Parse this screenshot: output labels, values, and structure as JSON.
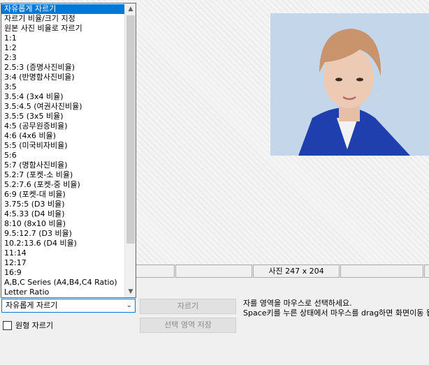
{
  "dropdown": {
    "items": [
      "자유롭게 자르기",
      "자르기 비율/크기 지정",
      "원본 사진 비율로 자르기",
      "1:1",
      "1:2",
      "2:3",
      "2.5:3 (증명사진비율)",
      "3:4 (반명함사진비율)",
      "3:5",
      "3.5:4 (3x4 비율)",
      "3.5:4.5 (여권사진비율)",
      "3.5:5 (3x5 비율)",
      "4:5 (공무원증비율)",
      "4:6 (4x6 비율)",
      "5:5 (미국비자비율)",
      "5:6",
      "5:7 (명함사진비율)",
      "5.2:7 (포켓-소 비율)",
      "5.2:7.6 (포켓-중 비율)",
      "6:9 (포켓-대 비율)",
      "3.75:5 (D3 비율)",
      "4:5.33 (D4 비율)",
      "8:10 (8x10 비율)",
      "9.5:12.7 (D3 비율)",
      "10.2:13.6 (D4 비율)",
      "11:14",
      "12:17",
      "16:9",
      "A,B,C Series (A4,B4,C4 Ratio)",
      "Letter Ratio"
    ],
    "selected_index": 0
  },
  "combo": {
    "value": "자유롭게 자르기"
  },
  "checkbox": {
    "label": "원형 자르기",
    "checked": false
  },
  "buttons": {
    "crop": "자르기",
    "save_selection": "선택 영역 저장"
  },
  "status": {
    "photo_size": "사진 247 x 204"
  },
  "hint": {
    "line1": "자를 영역을 마우스로 선택하세요.",
    "line2": "Space키를 누른 상태에서 마우스를 drag하면 화면이동 됩"
  }
}
